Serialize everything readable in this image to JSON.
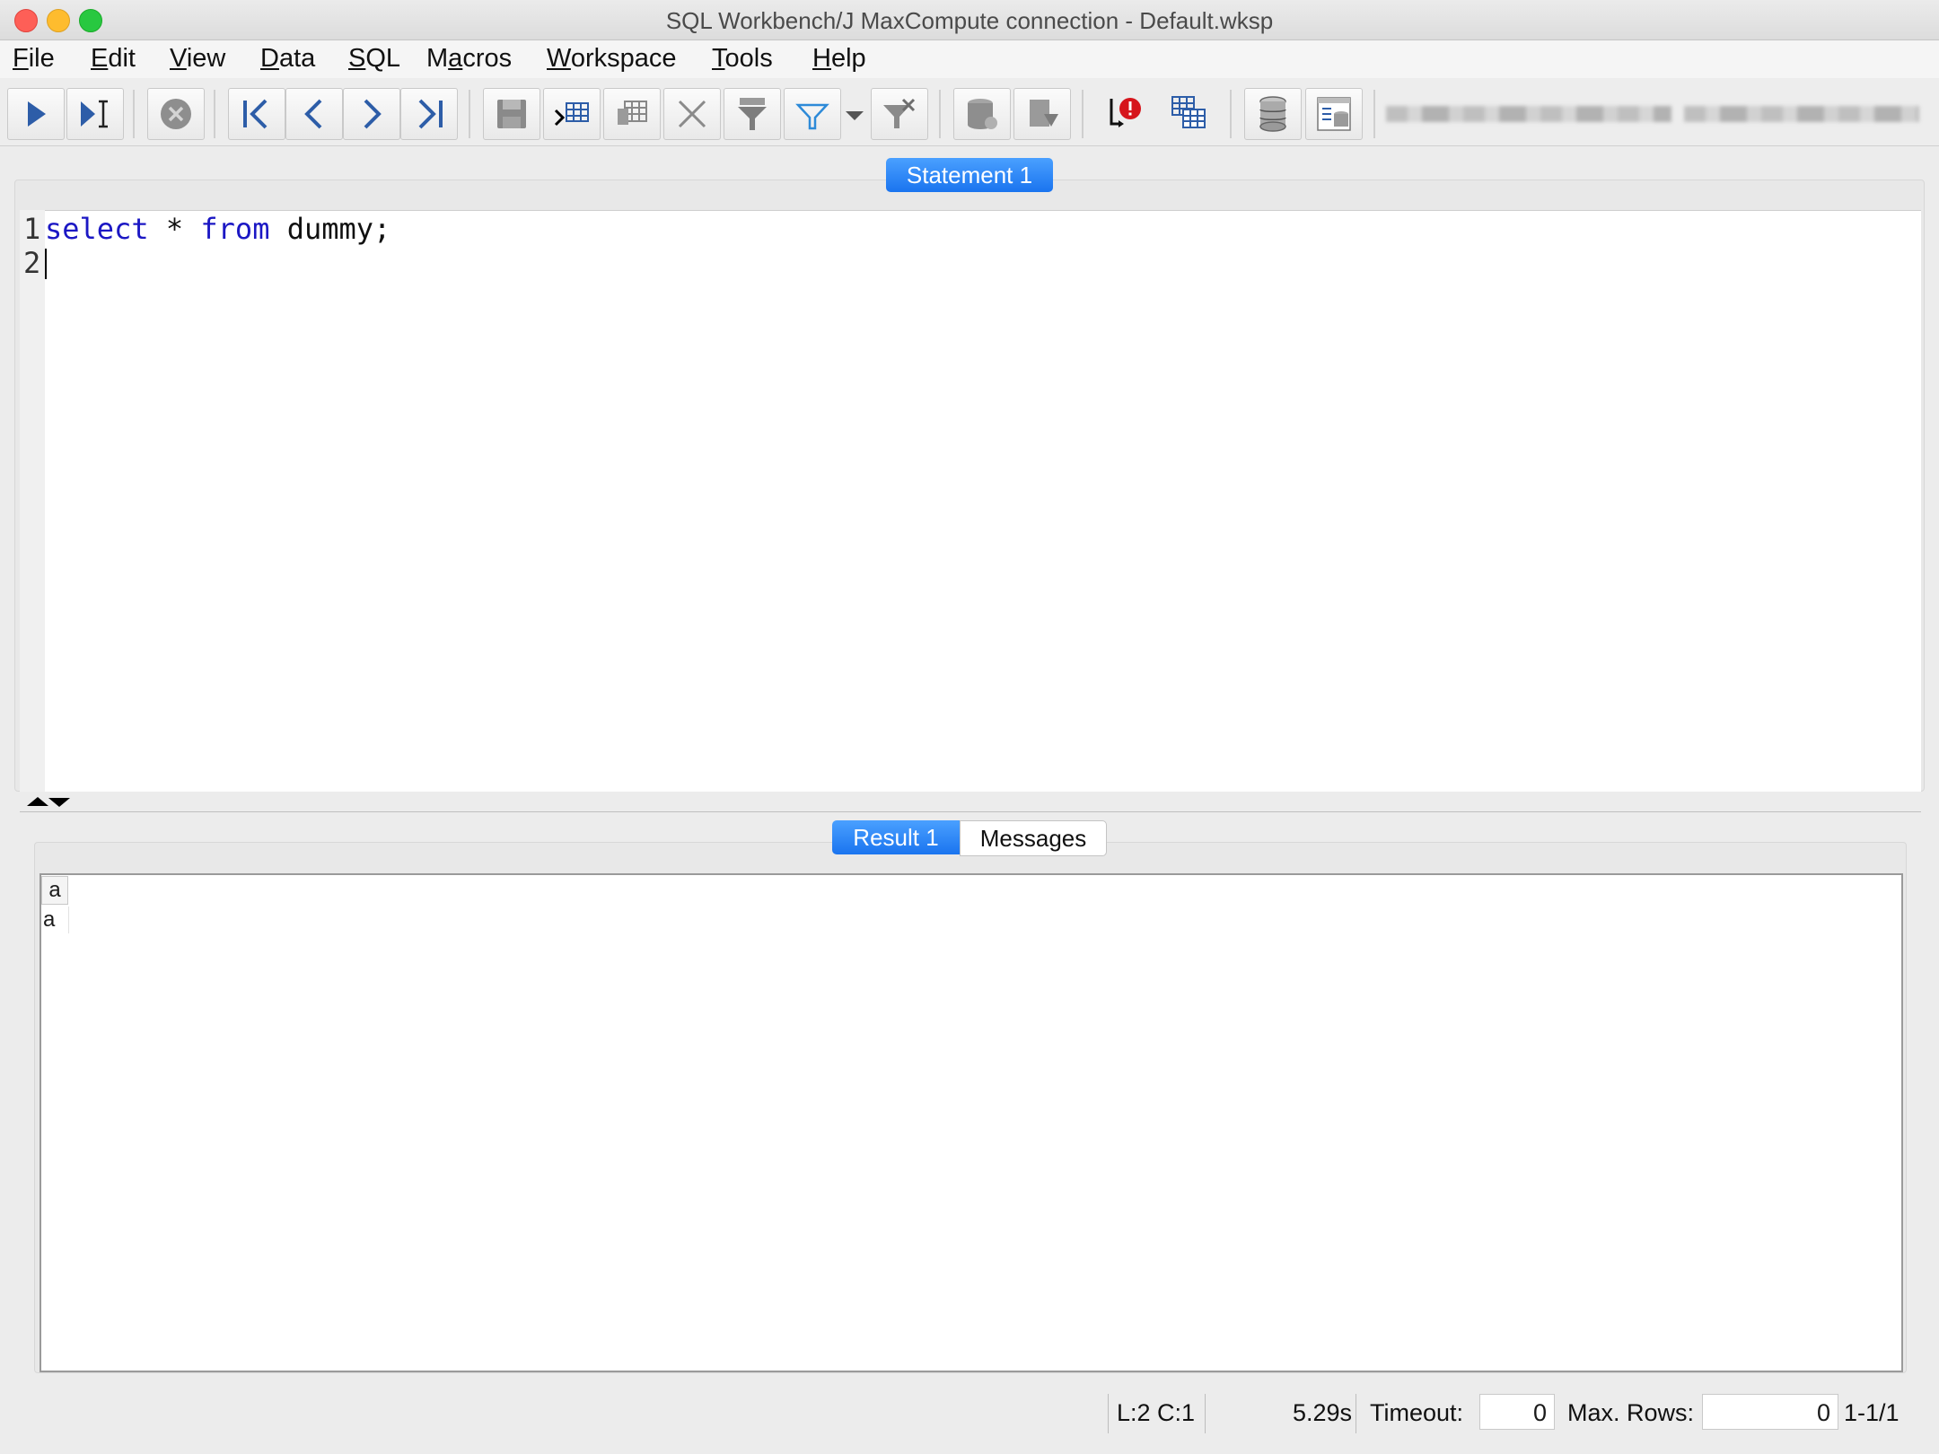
{
  "window": {
    "title": "SQL Workbench/J MaxCompute connection - Default.wksp"
  },
  "menu": {
    "items": [
      {
        "label_mn": "F",
        "label_rest": "ile"
      },
      {
        "label_mn": "E",
        "label_rest": "dit"
      },
      {
        "label_mn": "V",
        "label_rest": "iew"
      },
      {
        "label_mn": "D",
        "label_rest": "ata"
      },
      {
        "label_mn": "S",
        "label_rest": "QL"
      },
      {
        "label_pre": "M",
        "label_mn": "a",
        "label_rest": "cros"
      },
      {
        "label_mn": "W",
        "label_rest": "orkspace"
      },
      {
        "label_mn": "T",
        "label_rest": "ools"
      },
      {
        "label_mn": "H",
        "label_rest": "elp"
      }
    ]
  },
  "toolbar": {
    "icons": [
      "execute-icon",
      "execute-current-icon",
      "cancel-icon",
      "first-icon",
      "previous-icon",
      "next-icon",
      "last-icon",
      "save-icon",
      "insert-row-icon",
      "copy-row-icon",
      "delete-row-icon",
      "filter-icon",
      "quick-filter-icon",
      "filter-dropdown-icon",
      "reset-filter-icon",
      "commit-icon",
      "rollback-icon",
      "stop-on-error-icon",
      "data-grid-icon",
      "database-explorer-icon",
      "db-tree-icon"
    ]
  },
  "editor": {
    "tab_label": "Statement 1",
    "line_numbers": [
      "1",
      "2"
    ],
    "line1": {
      "kw1": "select",
      "op": " * ",
      "kw2": "from",
      "rest": " dummy;"
    }
  },
  "results": {
    "tabs": [
      "Result 1",
      "Messages"
    ],
    "columns": [
      "a"
    ],
    "rows": [
      [
        "a"
      ]
    ]
  },
  "status": {
    "cursor": "L:2 C:1",
    "time": "5.29s",
    "timeout_label": "Timeout:",
    "timeout_value": "0",
    "maxrows_label": "Max. Rows:",
    "maxrows_value": "0",
    "range": "1-1/1"
  }
}
